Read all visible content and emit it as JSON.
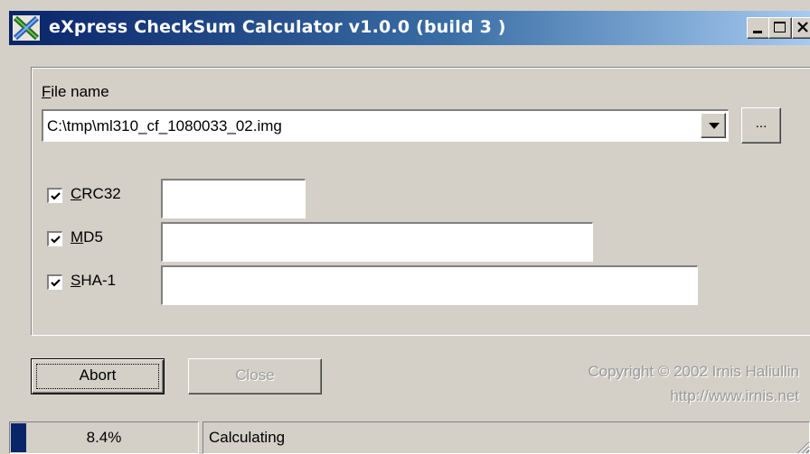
{
  "window": {
    "title": "eXpress CheckSum Calculator v1.0.0 (build 3 )",
    "icon": "app-x-icon",
    "controls": [
      "minimize-icon",
      "maximize-icon",
      "close-icon"
    ]
  },
  "file": {
    "label_prefix": "F",
    "label_rest": "ile name",
    "value": "C:\\tmp\\ml310_cf_1080033_02.img",
    "browse_label": "..."
  },
  "hashes": {
    "crc32": {
      "label_prefix": "C",
      "label_rest": "RC32",
      "checked": true,
      "value": ""
    },
    "md5": {
      "label_prefix": "M",
      "label_rest": "D5",
      "checked": true,
      "value": ""
    },
    "sha1": {
      "label_prefix": "S",
      "label_rest": "HA-1",
      "checked": true,
      "value": ""
    }
  },
  "buttons": {
    "abort": "Abort",
    "close": "Close"
  },
  "copyright": {
    "line1": "Copyright © 2002 Irnis Haliullin",
    "line2": "http://www.irnis.net"
  },
  "status": {
    "progress_fraction": 0.084,
    "progress_text": "8.4%",
    "message": "Calculating"
  },
  "colors": {
    "face": "#d4d0c8",
    "title_start": "#0a246a",
    "title_end": "#a6caf0",
    "progress": "#0a246a"
  }
}
